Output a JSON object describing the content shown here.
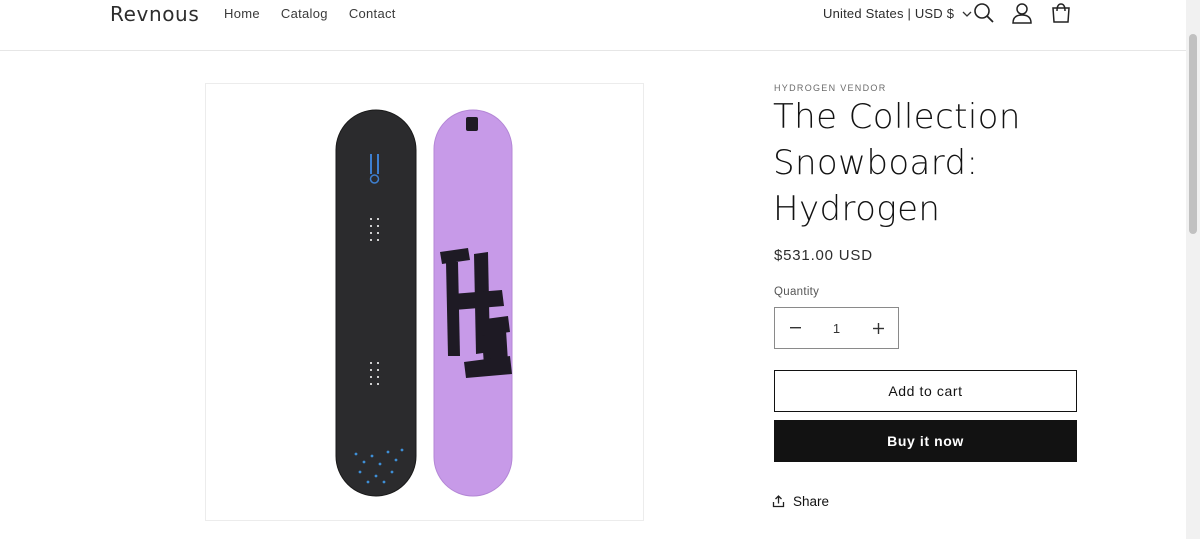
{
  "header": {
    "logo": "Revnous",
    "nav": [
      "Home",
      "Catalog",
      "Contact"
    ],
    "locale": "United States | USD $",
    "icons": [
      "search-icon",
      "account-icon",
      "cart-icon"
    ]
  },
  "product": {
    "vendor": "HYDROGEN VENDOR",
    "title": "The Collection Snowboard: Hydrogen",
    "price": "$531.00 USD",
    "quantity_label": "Quantity",
    "quantity_value": "1",
    "add_to_cart": "Add to cart",
    "buy_now": "Buy it now",
    "share": "Share",
    "image_board_colors": {
      "left": "#2b2b2d",
      "right": "#c79ae8",
      "graphic": "#1e1a24"
    },
    "board_graphic_text": "H2"
  }
}
